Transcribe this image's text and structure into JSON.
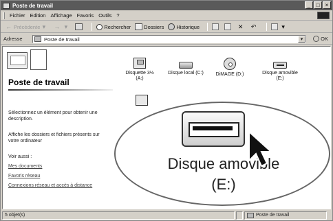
{
  "window": {
    "title": "Poste de travail"
  },
  "window_controls": [
    "_",
    "□",
    "×"
  ],
  "menu": [
    "Fichier",
    "Edition",
    "Affichage",
    "Favoris",
    "Outils",
    "?"
  ],
  "toolbar": {
    "back": "Précédente",
    "search": "Rechercher",
    "folders": "Dossiers",
    "history": "Historique"
  },
  "address": {
    "label": "Adresse",
    "value": "Poste de travail",
    "go": "OK"
  },
  "sidebar": {
    "title": "Poste de travail",
    "description": "Sélectionnez un élément pour obtenir une description.",
    "info": "Affiche les dossiers et fichiers présents sur votre ordinateur",
    "see_also": "Voir aussi :",
    "links": [
      "Mes documents",
      "Favoris réseau",
      "Connexions réseau et accès à distance"
    ]
  },
  "drives": [
    {
      "label": "Disquette 3½",
      "sub": "(A:)",
      "icon": "floppy-drive-icon"
    },
    {
      "label": "Disque local (C:)",
      "sub": "",
      "icon": "hard-disk-icon"
    },
    {
      "label": "DiMAGE (D:)",
      "sub": "",
      "icon": "cd-drive-icon"
    },
    {
      "label": "Disque amovible",
      "sub": "(E:)",
      "icon": "removable-disk-icon"
    }
  ],
  "zoom": {
    "line1": "Disque amovible",
    "line2": "(E:)"
  },
  "status": {
    "objects": "5 objet(s)",
    "location": "Poste de travail"
  }
}
